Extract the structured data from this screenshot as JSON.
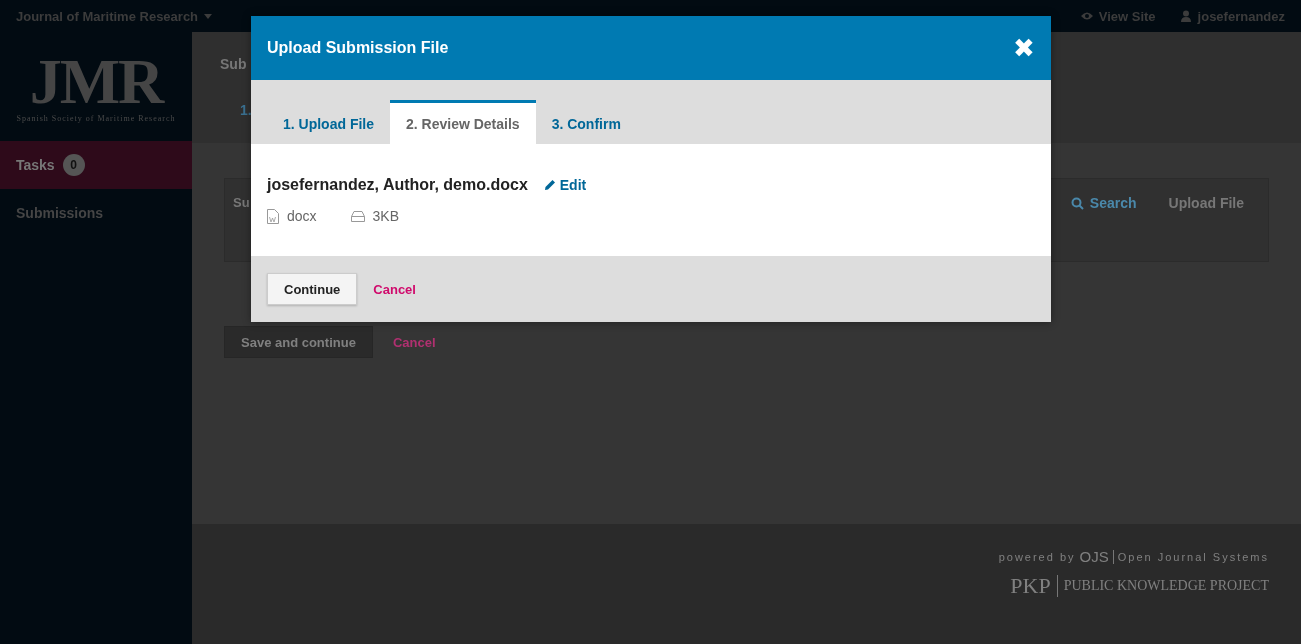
{
  "header": {
    "journal": "Journal of Maritime Research",
    "view_site": "View Site",
    "user": "josefernandez"
  },
  "sidebar": {
    "logo": {
      "title": "JMR",
      "subtitle": "Spanish Society of Maritime Research"
    },
    "items": [
      {
        "label": "Tasks",
        "badge": "0",
        "selected": true
      },
      {
        "label": "Submissions",
        "selected": false
      }
    ]
  },
  "page": {
    "title": "Sub",
    "step": "1.",
    "panel": {
      "title": "Su",
      "actions": [
        {
          "label": "Search",
          "kind": "search"
        },
        {
          "label": "Upload File",
          "kind": "plain"
        }
      ]
    },
    "save": "Save and continue",
    "cancel": "Cancel"
  },
  "footer": {
    "powered_by": "powered by",
    "ojs": "OJS",
    "ojs_name": "Open Journal Systems",
    "pkp": "PKP",
    "pkp_name": "PUBLIC KNOWLEDGE PROJECT"
  },
  "modal": {
    "title": "Upload Submission File",
    "close": "✖",
    "tabs": [
      {
        "label": "1. Upload File",
        "selected": false
      },
      {
        "label": "2. Review Details",
        "selected": true
      },
      {
        "label": "3. Confirm",
        "selected": false
      }
    ],
    "file": {
      "name": "josefernandez, Author, demo.docx",
      "edit": "Edit",
      "type": "docx",
      "size": "3KB"
    },
    "continue": "Continue",
    "cancel": "Cancel"
  }
}
